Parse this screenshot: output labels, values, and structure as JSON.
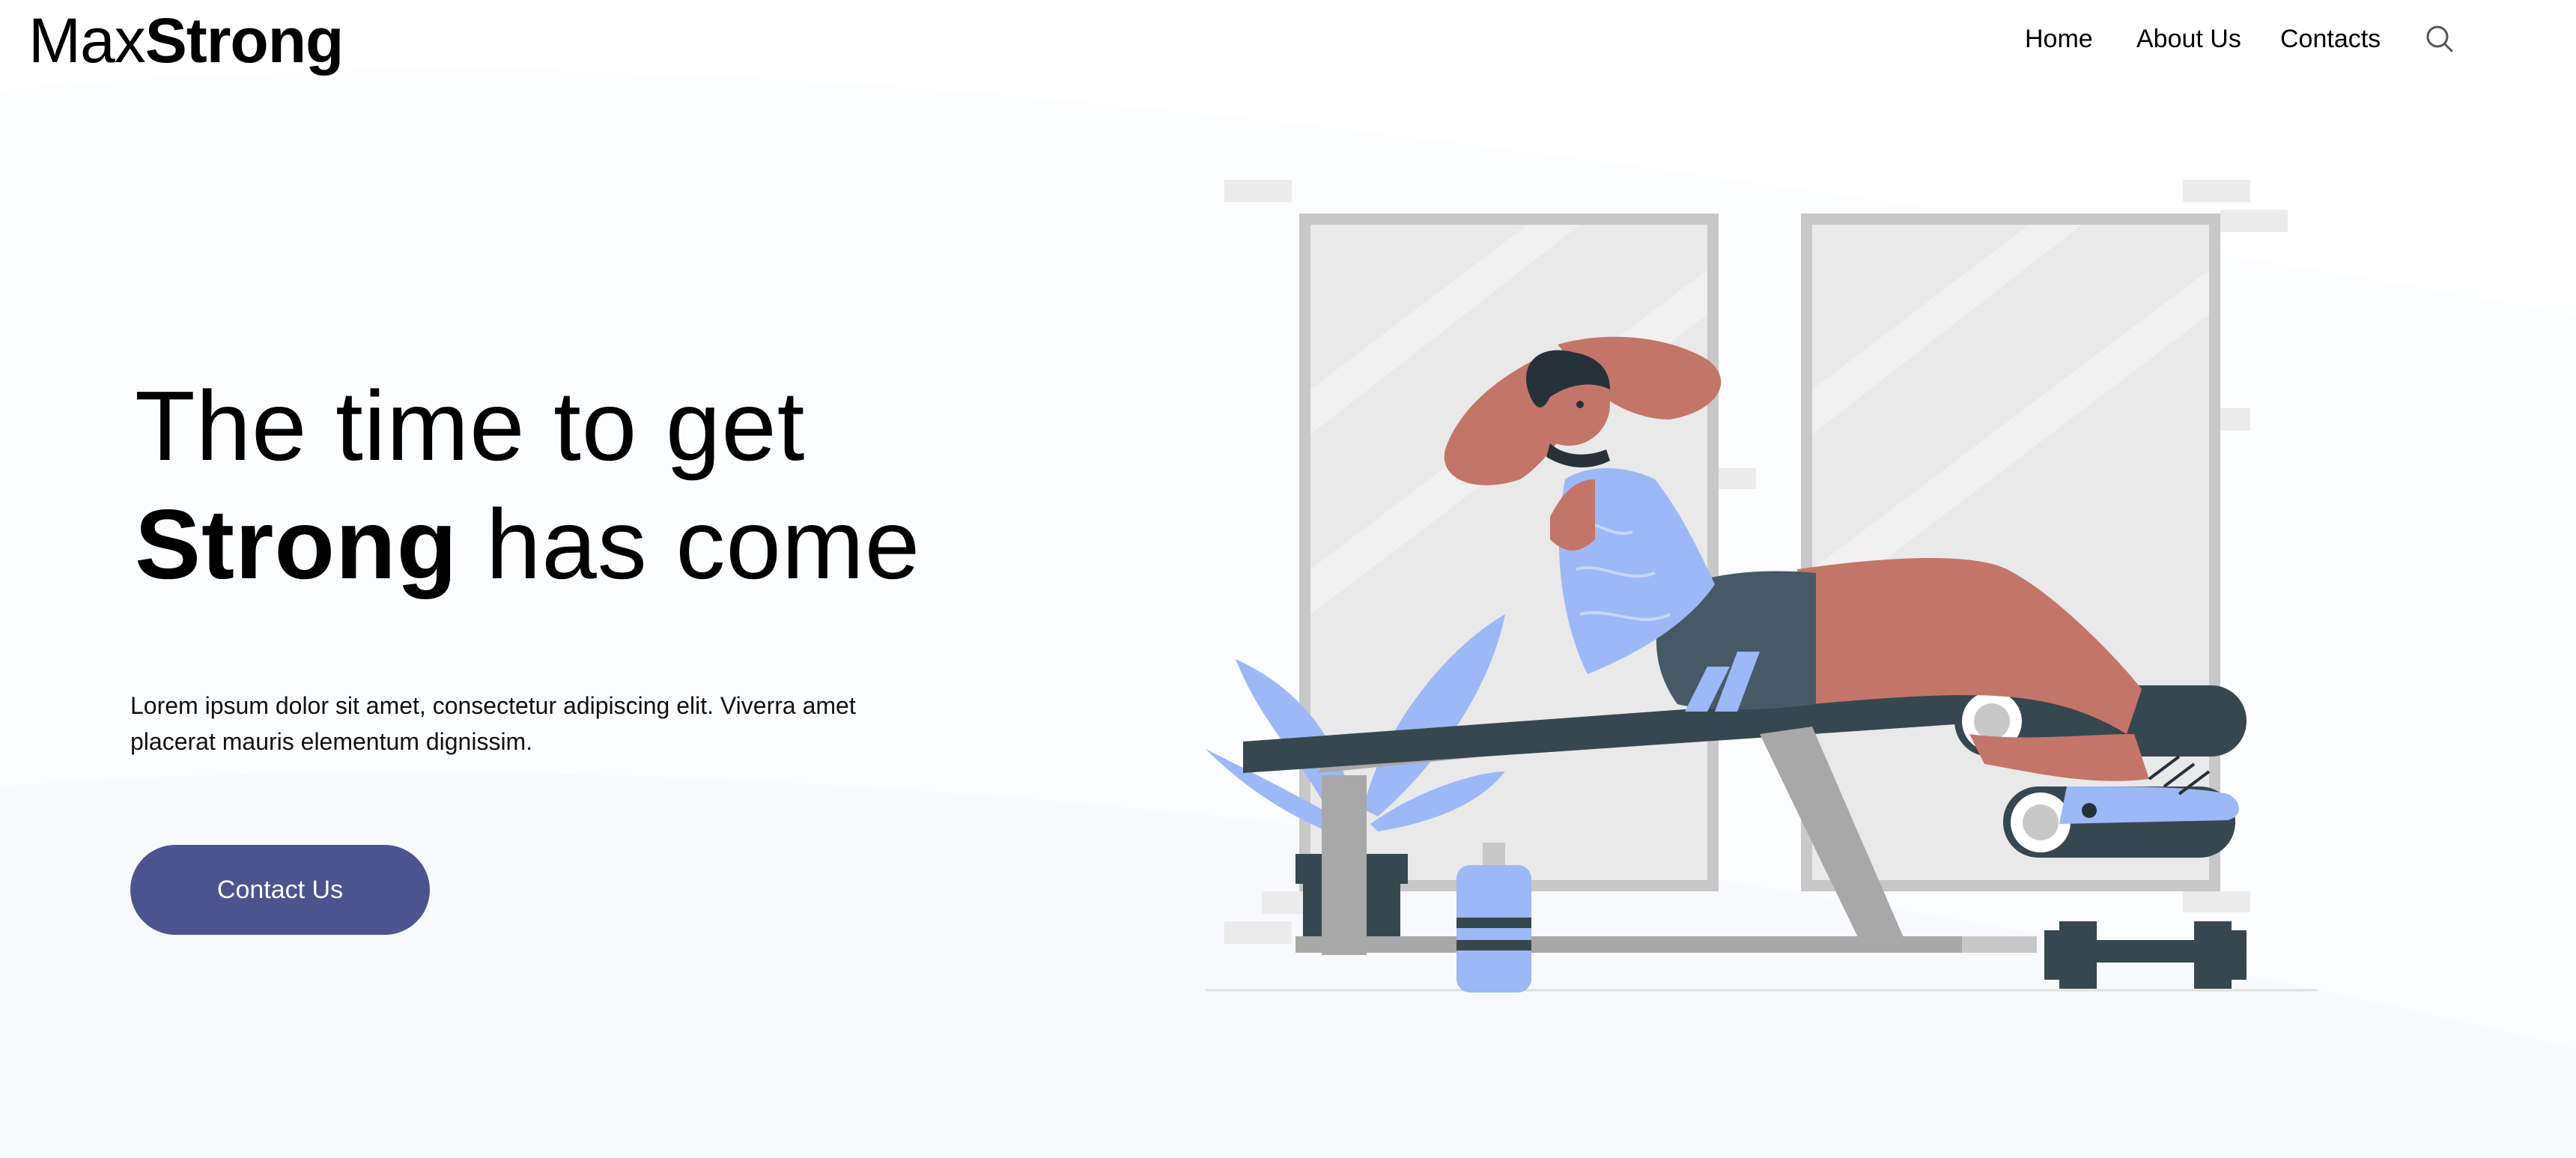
{
  "header": {
    "logo_light": "Max",
    "logo_bold": "Strong",
    "nav": {
      "home": "Home",
      "about": "About Us",
      "contacts": "Contacts"
    },
    "search_icon": "search-icon"
  },
  "hero": {
    "title_line1": "The time to get",
    "title_strong": "Strong",
    "title_rest": " has come",
    "body": "Lorem ipsum dolor sit amet, consectetur adipiscing elit. Viverra amet placerat mauris elementum dignissim.",
    "cta_label": "Contact Us"
  },
  "colors": {
    "accent": "#4c5490",
    "skin": "#c4756a",
    "shirt": "#9db8f7",
    "dark": "#37474f",
    "mirror": "#e8e8e8",
    "mirror_frame": "#c8c8c8"
  },
  "illustration": {
    "name": "man-doing-situps-on-gym-bench"
  }
}
